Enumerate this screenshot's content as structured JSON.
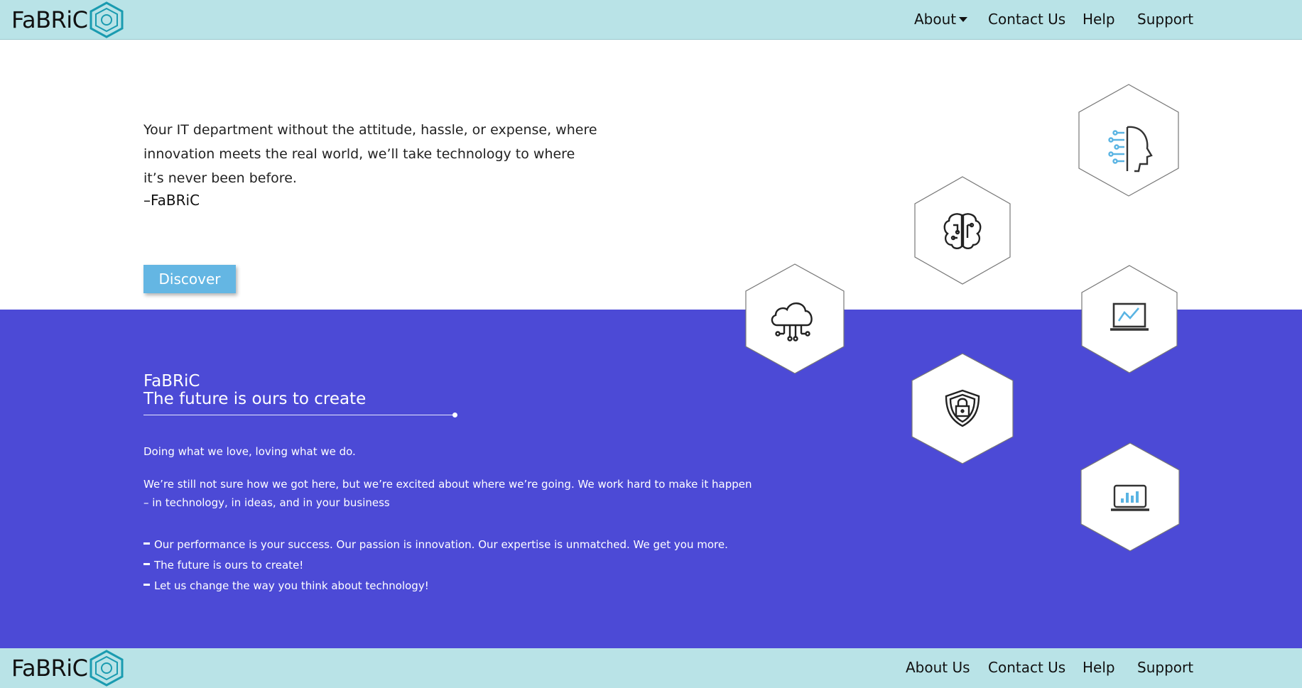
{
  "header": {
    "logo_text": "FaBRiC",
    "nav": {
      "about": "About",
      "contact": "Contact Us",
      "help": "Help",
      "support": "Support"
    }
  },
  "hero": {
    "quote": "Your IT department without the attitude, hassle, or expense, where innovation meets the real world, we’ll take technology to where it’s never been before.",
    "signature": "–FaBRiC",
    "cta_label": "Discover"
  },
  "band": {
    "title": "FaBRiC",
    "subtitle": "The future is ours to create",
    "paragraph1": "Doing what we love, loving what we do.",
    "paragraph2": "We’re still not sure how we got here, but we’re excited about where we’re going. We work hard to make it happen – in technology, in ideas, and in your business",
    "bullets": [
      "Our performance is your success. Our passion is innovation. Our expertise is unmatched. We get you more.",
      "The future is ours to create!",
      "Let us change the way you think about technology!"
    ]
  },
  "hex_icons": [
    "ai-head-icon",
    "brain-circuit-icon",
    "cloud-network-icon",
    "laptop-line-chart-icon",
    "shield-lock-icon",
    "laptop-bar-chart-icon"
  ],
  "footer": {
    "logo_text": "FaBRiC",
    "nav": {
      "about": "About Us",
      "contact": "Contact Us",
      "help": "Help",
      "support": "Support"
    }
  },
  "colors": {
    "header_bg": "#b9e3e7",
    "band_bg": "#4c4ad6",
    "accent_blue": "#64b6e3",
    "logo_teal": "#1a9bb0"
  }
}
